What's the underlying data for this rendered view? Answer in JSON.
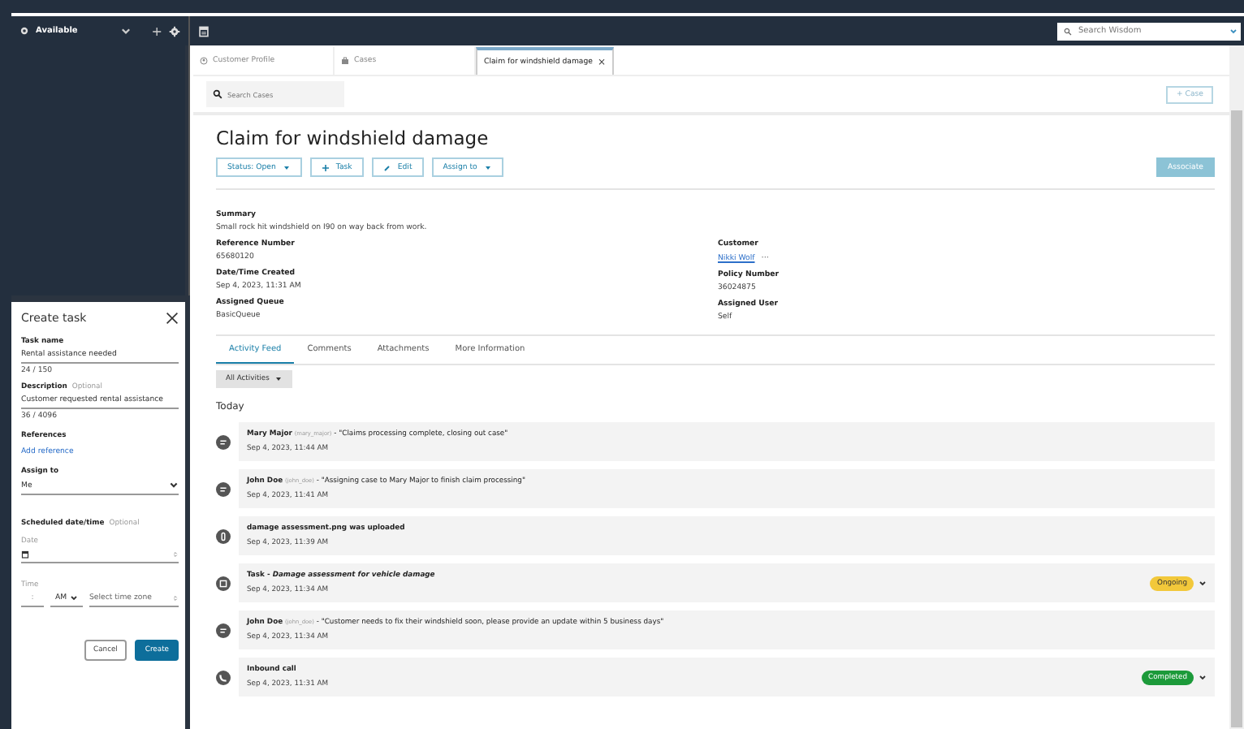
{
  "agent_status": {
    "label": "Available",
    "add_icon": "+"
  },
  "search_wisdom": {
    "placeholder": "Search Wisdom"
  },
  "tabs": [
    {
      "label": "Customer Profile",
      "kind": "profile",
      "selected": false
    },
    {
      "label": "Cases",
      "kind": "cases",
      "selected": false
    },
    {
      "label": "Claim for windshield damage",
      "kind": "case",
      "selected": true,
      "close": "×"
    }
  ],
  "search_cases": {
    "placeholder": "Search Cases"
  },
  "new_case_button": "+ Case",
  "case": {
    "title": "Claim for windshield damage",
    "actions": [
      {
        "label": "Status: Open",
        "kind": "dropdown"
      },
      {
        "label": "Task",
        "kind": "add"
      },
      {
        "label": "Edit",
        "kind": "edit"
      },
      {
        "label": "Assign to",
        "kind": "dropdown"
      }
    ],
    "associate_button": "Associate",
    "summary": {
      "label": "Summary",
      "value": "Small rock hit windshield on I90 on way back from work."
    },
    "left_fields": [
      {
        "label": "Reference Number",
        "value": "65680120"
      },
      {
        "label": "Date/Time Created",
        "value": "Sep 4, 2023, 11:31 AM"
      },
      {
        "label": "Assigned Queue",
        "value": "BasicQueue"
      }
    ],
    "right_fields": [
      {
        "label": "Customer",
        "value": "Nikki Wolf",
        "kind": "link",
        "more": "···"
      },
      {
        "label": "Policy Number",
        "value": "36024875",
        "kind": "text"
      },
      {
        "label": "Assigned User",
        "value": "Self",
        "kind": "text"
      }
    ]
  },
  "detail_tabs": [
    {
      "label": "Activity Feed",
      "selected": true
    },
    {
      "label": "Comments",
      "selected": false
    },
    {
      "label": "Attachments",
      "selected": false
    },
    {
      "label": "More Information",
      "selected": false
    }
  ],
  "filter": "All Activities",
  "feed_heading": "Today",
  "feed": [
    {
      "kind": "comment",
      "author": "Mary Major",
      "handle": "(mary_major)",
      "message": " - \"Claims processing complete, closing out case\"",
      "time": "Sep 4, 2023, 11:44 AM"
    },
    {
      "kind": "comment",
      "author": "John Doe",
      "handle": "(john_doe)",
      "message": " - \"Assigning case to Mary Major to finish claim processing\"",
      "time": "Sep 4, 2023, 11:41 AM"
    },
    {
      "kind": "file",
      "title": "damage assessment.png was uploaded",
      "time": "Sep 4, 2023, 11:39 AM"
    },
    {
      "kind": "task",
      "title": "Task - *Damage assessment for vehicle damage*",
      "time": "Sep 4, 2023, 11:34 AM",
      "badge": "Ongoing",
      "color": "#f2c83a"
    },
    {
      "kind": "comment",
      "author": "John Doe",
      "handle": "(john_doe)",
      "message": " - \"Customer needs to fix their windshield soon, please provide an update within 5 business days\"",
      "time": "Sep 4, 2023, 11:34 AM"
    },
    {
      "kind": "call",
      "title": "Inbound call",
      "time": "Sep 4, 2023, 11:31 AM",
      "badge": "Completed",
      "color": "#1c9a3a"
    }
  ],
  "create_task": {
    "title": "Create task",
    "task_name": {
      "label": "Task name",
      "value": "Rental assistance needed",
      "count": "24 / 150"
    },
    "description": {
      "label": "Description",
      "optional": "Optional",
      "value": "Customer requested rental assistance",
      "count": "36 / 4096"
    },
    "references": {
      "label": "References",
      "link": "Add reference"
    },
    "assign_to": {
      "label": "Assign to",
      "value": "Me"
    },
    "scheduled": {
      "label": "Scheduled date/time",
      "optional": "Optional"
    },
    "date_label": "Date",
    "time_label": "Time",
    "time_separator": ":",
    "ampm": "AM",
    "timezone_placeholder": "Select time zone",
    "buttons": [
      {
        "label": "Cancel",
        "kind": "secondary"
      },
      {
        "label": "Create",
        "kind": "primary"
      }
    ]
  }
}
